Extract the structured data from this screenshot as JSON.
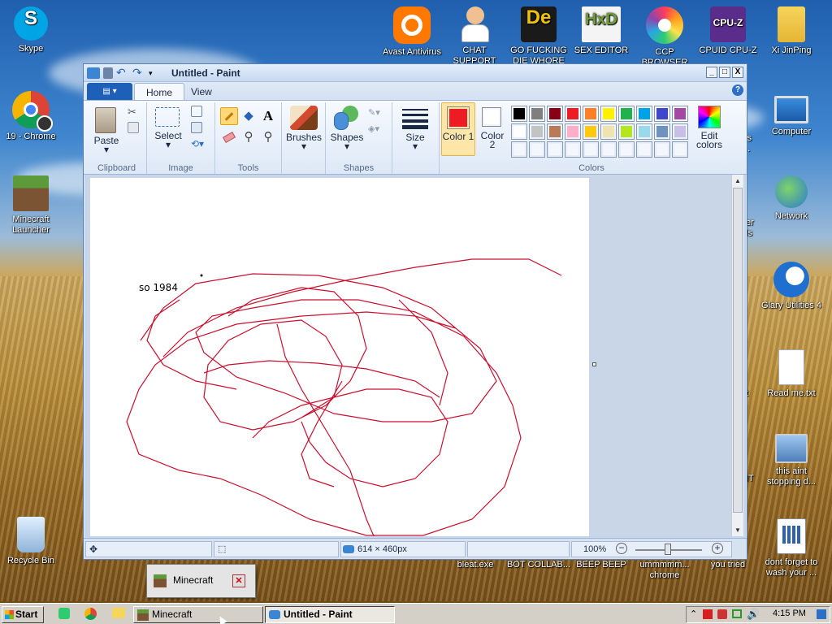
{
  "desktop": {
    "icons_left": [
      {
        "label": "Skype"
      },
      {
        "label": "19 - Chrome"
      },
      {
        "label": "Minecraft Launcher"
      },
      {
        "label": "Recycle Bin"
      }
    ],
    "icons_top": [
      {
        "label": "Avast Antivirus"
      },
      {
        "label": "CHAT SUPPORT"
      },
      {
        "label": "GO FUCKING DIE WHORE"
      },
      {
        "label": "SEX EDITOR"
      },
      {
        "label": "CCP BROWSER"
      },
      {
        "label": "CPUID CPU-Z"
      },
      {
        "label": "Xi JinPing"
      }
    ],
    "icons_right": [
      {
        "label": "Computer"
      },
      {
        "label": "Network"
      },
      {
        "label": "Glary Utilities 4"
      },
      {
        "label": "Read me.txt"
      },
      {
        "label": "this aint stopping d..."
      },
      {
        "label": "dont forget to wash your ..."
      }
    ],
    "icons_bottom": [
      {
        "label": "bleat.exe"
      },
      {
        "label": "BOT COLLAB..."
      },
      {
        "label": "BEEP BEEP"
      },
      {
        "label": "ummmmm... chrome"
      },
      {
        "label": "you tried"
      }
    ],
    "partial_labels": [
      "ys",
      "...",
      "er",
      "ls",
      "t",
      "IT"
    ]
  },
  "paint": {
    "title": "Untitled - Paint",
    "window_controls": [
      "_",
      "□",
      "X"
    ],
    "tabs": {
      "home": "Home",
      "view": "View"
    },
    "clipboard": {
      "paste": "Paste",
      "group": "Clipboard"
    },
    "image": {
      "select": "Select",
      "group": "Image"
    },
    "tools": {
      "group": "Tools"
    },
    "brushes": {
      "label": "Brushes"
    },
    "shapes": {
      "label": "Shapes",
      "group": "Shapes"
    },
    "size": {
      "label": "Size"
    },
    "color1": {
      "label": "Color 1",
      "value": "#ed1c24"
    },
    "color2": {
      "label": "Color 2",
      "value": "#ffffff"
    },
    "colors_group": "Colors",
    "edit_colors": "Edit colors",
    "palette_row1": [
      "#000000",
      "#7f7f7f",
      "#880015",
      "#ed1c24",
      "#ff7f27",
      "#fff200",
      "#22b14c",
      "#00a2e8",
      "#3f48cc",
      "#a349a4"
    ],
    "palette_row2": [
      "#ffffff",
      "#c3c3c3",
      "#b97a57",
      "#ffaec9",
      "#ffc90e",
      "#efe4b0",
      "#b5e61d",
      "#99d9ea",
      "#7092be",
      "#c8bfe7"
    ],
    "canvas_text": "so 1984",
    "status": {
      "dimensions": "614 × 460px",
      "zoom": "100%"
    }
  },
  "popup": {
    "label": "Minecraft"
  },
  "taskbar": {
    "start": "Start",
    "buttons": [
      {
        "label": "Minecraft"
      },
      {
        "label": "Untitled - Paint"
      }
    ],
    "clock": "4:15 PM"
  }
}
